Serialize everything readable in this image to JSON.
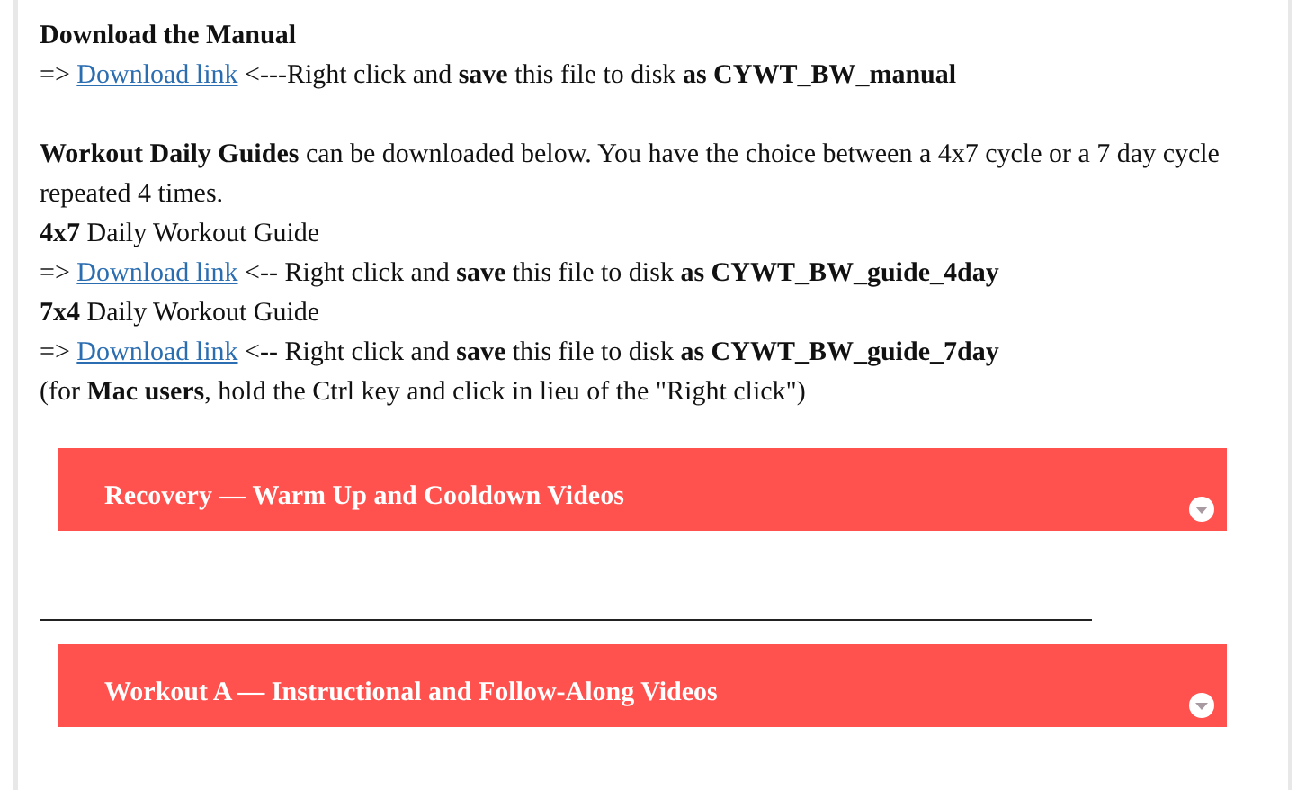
{
  "manual": {
    "heading": "Download the Manual",
    "line": {
      "prefix": "=>",
      "link": "Download link",
      "suffix": "<---Right click and **save** this file to disk **as CYWT_BW_manual**"
    }
  },
  "guides": {
    "intro": "**Workout Daily Guides** can be downloaded below. You have the choice between a 4x7 cycle or a 7 day cycle repeated 4 times.",
    "items": [
      {
        "label": "**4x7** Daily Workout Guide",
        "line": {
          "prefix": "=>",
          "link": "Download link",
          "suffix": "<-- Right click and **save** this file to disk **as CYWT_BW_guide_4day**"
        }
      },
      {
        "label": "**7x4** Daily Workout Guide",
        "line": {
          "prefix": "=>",
          "link": "Download link",
          "suffix": "<-- Right click and **save** this file to disk **as CYWT_BW_guide_7day**"
        }
      }
    ],
    "note": "(for **Mac users**, hold the Ctrl key and click in lieu of the \"Right click\")"
  },
  "sections": [
    {
      "title": "Recovery — Warm Up and Cooldown Videos",
      "expanded": false
    },
    {
      "title": "Workout A — Instructional and Follow-Along Videos",
      "expanded": false
    }
  ]
}
